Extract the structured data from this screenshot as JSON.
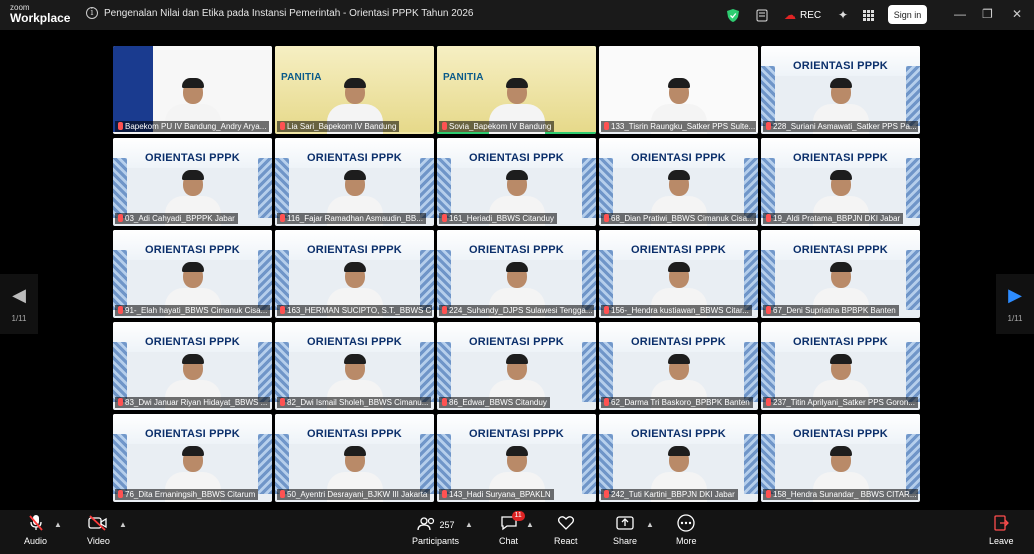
{
  "app": {
    "logo_line1": "zoom",
    "logo_line2": "Workplace",
    "meeting_title": "Pengenalan Nilai dan Etika pada Instansi Pemerintah - Orientasi PPPK Tahun 2026",
    "rec_label": "REC",
    "signin_label": "Sign in",
    "accent_color": "#2d8cff",
    "active_speaker_color": "#2ecc71"
  },
  "pagination": {
    "left": "1/11",
    "right": "1/11"
  },
  "tiles": [
    {
      "name": "Bapekom PU IV Bandung_Andry Arya...",
      "heading": "",
      "style": "first",
      "active": false
    },
    {
      "name": "Lia Sari_Bapekom IV Bandung",
      "heading": "PANITIA",
      "style": "panitia",
      "active": false
    },
    {
      "name": "Sovia_Bapekom IV Bandung",
      "heading": "PANITIA",
      "style": "panitia",
      "active": true
    },
    {
      "name": "133_Tisrin Raungku_Satker PPS Sulte...",
      "heading": "",
      "style": "plain",
      "active": false
    },
    {
      "name": "228_Suriani Asmawati_Satker PPS Pa...",
      "heading": "ORIENTASI PPPK",
      "style": "orient",
      "active": false
    },
    {
      "name": "03_Adi Cahyadi_BPPPK Jabar",
      "heading": "ORIENTASI PPPK",
      "style": "orient",
      "active": false
    },
    {
      "name": "116_Fajar Ramadhan Asmaudin_BB...",
      "heading": "ORIENTASI PPPK",
      "style": "orient",
      "active": false
    },
    {
      "name": "161_Heriadi_BBWS Citanduy",
      "heading": "ORIENTASI PPPK",
      "style": "orient",
      "active": false
    },
    {
      "name": "68_Dian Pratiwi_BBWS Cimanuk Cisa...",
      "heading": "ORIENTASI PPPK",
      "style": "orient",
      "active": false
    },
    {
      "name": "19_Aldi Pratama_BBPJN DKI Jabar",
      "heading": "ORIENTASI PPPK",
      "style": "orient",
      "active": false
    },
    {
      "name": "91-_Elah hayati_BBWS Cimanuk Cisa...",
      "heading": "ORIENTASI PPPK",
      "style": "orient",
      "active": false
    },
    {
      "name": "163_HERMAN SUCIPTO, S.T._BBWS C...",
      "heading": "ORIENTASI PPPK",
      "style": "orient",
      "active": false
    },
    {
      "name": "224_Suhandy_DJPS Sulawesi Tengga...",
      "heading": "ORIENTASI PPPK",
      "style": "orient",
      "active": false
    },
    {
      "name": "156-_Hendra kustiawan_BBWS Citar...",
      "heading": "ORIENTASI PPPK",
      "style": "orient",
      "active": false
    },
    {
      "name": "67_Deni Supriatna BPBPK Banten",
      "heading": "ORIENTASI PPPK",
      "style": "orient",
      "active": false
    },
    {
      "name": "83_Dwi Januar Riyan Hidayat_BBWS ...",
      "heading": "ORIENTASI PPPK",
      "style": "orient",
      "active": false
    },
    {
      "name": "82_Dwi Ismail Sholeh_BBWS Cimanu...",
      "heading": "ORIENTASI PPPK",
      "style": "orient",
      "active": false
    },
    {
      "name": "86_Edwar_BBWS Citanduy",
      "heading": "ORIENTASI PPPK",
      "style": "orient",
      "active": false
    },
    {
      "name": "62_Darma Tri Baskoro_BPBPK Banten",
      "heading": "ORIENTASI PPPK",
      "style": "orient",
      "active": false
    },
    {
      "name": "237_Titin Aprilyani_Satker PPS Goron...",
      "heading": "ORIENTASI PPPK",
      "style": "orient",
      "active": false
    },
    {
      "name": "76_Dita Ernaningsih_BBWS Citarum",
      "heading": "ORIENTASI PPPK",
      "style": "orient",
      "active": false
    },
    {
      "name": "50_Ayentri Desrayani_BJKW III Jakarta",
      "heading": "ORIENTASI PPPK",
      "style": "orient",
      "active": false
    },
    {
      "name": "143_Hadi Suryana_BPAKLN",
      "heading": "ORIENTASI PPPK",
      "style": "orient",
      "active": false
    },
    {
      "name": "242_Tuti Kartini_BBPJN DKI Jabar",
      "heading": "ORIENTASI PPPK",
      "style": "orient",
      "active": false
    },
    {
      "name": "158_Hendra Sunandar_ BBWS CITAR...",
      "heading": "ORIENTASI PPPK",
      "style": "orient",
      "active": false
    }
  ],
  "toolbar": {
    "audio": "Audio",
    "video": "Video",
    "participants": "Participants",
    "participants_count": "257",
    "chat": "Chat",
    "chat_badge": "11",
    "react": "React",
    "share": "Share",
    "more": "More",
    "leave": "Leave"
  }
}
